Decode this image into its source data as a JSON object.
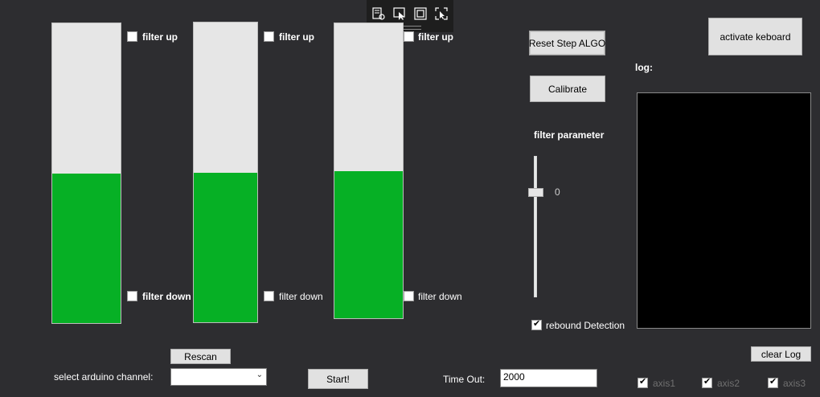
{
  "bars": [
    {
      "filter_up": "filter up",
      "filter_down": "filter down",
      "level": 0.5
    },
    {
      "filter_up": "filter up",
      "filter_down": "filter down",
      "level": 0.5
    },
    {
      "filter_up": "filter up",
      "filter_down": "filter down",
      "level": 0.5
    }
  ],
  "buttons": {
    "reset": "Reset Step ALGO",
    "calibrate": "Calibrate",
    "activate": "activate keboard",
    "rescan": "Rescan",
    "start": "Start!",
    "clear_log": "clear Log"
  },
  "log_label": "log:",
  "filter_parameter": {
    "label": "filter parameter",
    "value": "0"
  },
  "rebound": {
    "label": "rebound Detection",
    "checked": true
  },
  "select_channel": {
    "label": "select arduino channel:",
    "value": ""
  },
  "timeout": {
    "label": "Time Out:",
    "value": "2000"
  },
  "axes": [
    {
      "label": "axis1",
      "checked": true
    },
    {
      "label": "axis2",
      "checked": true
    },
    {
      "label": "axis3",
      "checked": true
    }
  ],
  "colors": {
    "background": "#2d2d30",
    "progress_fill": "#06b025",
    "log_bg": "#000000"
  },
  "toolbar_icons": [
    "select-element-icon",
    "cursor-select-icon",
    "display-adorners-icon",
    "track-focus-icon"
  ]
}
